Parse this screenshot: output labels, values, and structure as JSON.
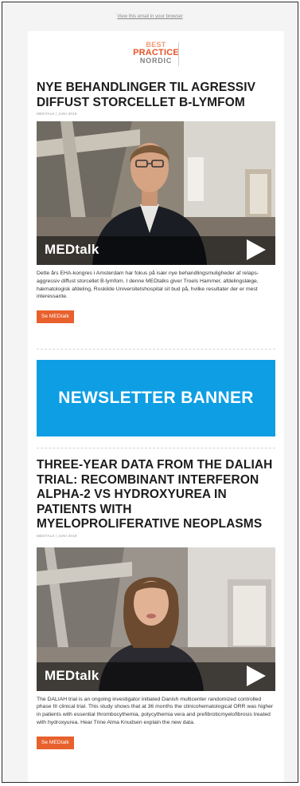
{
  "header": {
    "browser_link": "View this email in your browser"
  },
  "logo": {
    "line1": "BEST",
    "line2": "PRACTICE",
    "line3": "NORDIC"
  },
  "articles": [
    {
      "title": "NYE BEHANDLINGER TIL AGRESSIV DIFFUST STORCELLET B-LYMFOM",
      "meta": "MEDTALK | JUNI 2019",
      "video_brand": "MEDtalk",
      "description": "Dette års EHA-kongres i Amsterdam har fokus på især nye behandlingsmuligheder af relaps-aggressiv diffust storcellet B-lymfom. I denne MEDtalks giver Troels Hammer, afdelingslæge, hæmatologisk afdeling, Roskilde Universitetshospital sit bud på, hvilke resultater der er mest interessante.",
      "cta": "Se MEDtalk"
    },
    {
      "title": "THREE-YEAR DATA FROM THE DALIAH TRIAL: RECOMBINANT INTERFERON ALPHA-2 VS HYDROXYUREA IN PATIENTS WITH MYELOPROLIFERATIVE NEOPLASMS",
      "meta": "MEDTALK | JUNI 2019",
      "video_brand": "MEDtalk",
      "description": "The DALIAH trial is an ongoing investigator initiated Danish multicenter randomized controlled phase III clinical trial. This study shows that at 36 months the clinicohematological ORR was higher in patients with essential thrombocythemia, polycythemia vera and prefibroticmyelofibrosis treated with hydroxyurea. Hear Trine Alma Knudsen explain the new data.",
      "cta": "Se MEDtalk"
    }
  ],
  "banner": {
    "label": "NEWSLETTER BANNER",
    "color": "#0e9ee4"
  },
  "colors": {
    "accent": "#e8602c",
    "logo_orange": "#e5552a",
    "logo_gray": "#7f7f7f"
  }
}
